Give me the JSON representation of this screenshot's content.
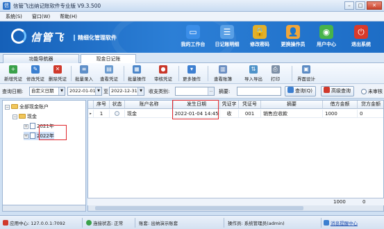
{
  "window": {
    "title": "信管飞出纳记账软件专业版 V9.3.500",
    "min": "–",
    "max": "□",
    "close": "✕"
  },
  "menu": [
    "系统(S)",
    "窗口(W)",
    "帮助(H)"
  ],
  "banner": {
    "logo": "信管飞",
    "slogan": "精细化管理软件",
    "tools": [
      {
        "label": "我的工作台",
        "icon": "monitor-icon",
        "color": "#3b8ee8",
        "glyph": "▭"
      },
      {
        "label": "日记账明细",
        "icon": "ledger-icon",
        "color": "#5aa0e6",
        "glyph": "☰"
      },
      {
        "label": "修改密码",
        "icon": "lock-icon",
        "color": "#e2b02a",
        "glyph": "🔒"
      },
      {
        "label": "更换操作员",
        "icon": "user-icon",
        "color": "#f0a63a",
        "glyph": "👤"
      },
      {
        "label": "用户中心",
        "icon": "globe-icon",
        "color": "#47b34a",
        "glyph": "◉"
      },
      {
        "label": "退出系统",
        "icon": "power-icon",
        "color": "#d93a2b",
        "glyph": "⏻"
      }
    ]
  },
  "tabs": [
    {
      "label": "功能导航器",
      "active": false
    },
    {
      "label": "现金日记账",
      "active": true
    }
  ],
  "toolbar": [
    {
      "label": "新增凭证",
      "icon": "add-icon",
      "color": "#3aa14a",
      "glyph": "+"
    },
    {
      "label": "修改凭证",
      "icon": "edit-icon",
      "color": "#3a7fd0",
      "glyph": "✎"
    },
    {
      "label": "删除凭证",
      "icon": "delete-icon",
      "color": "#d0392b",
      "glyph": "✕"
    },
    {
      "label": "批量录入",
      "icon": "batch-input-icon",
      "color": "#5f8fc8",
      "glyph": "≡"
    },
    {
      "label": "查看凭证",
      "icon": "view-icon",
      "color": "#6a9bd0",
      "glyph": "▤"
    },
    {
      "label": "批量操作",
      "icon": "batch-icon",
      "color": "#4c86c9",
      "glyph": "▦"
    },
    {
      "label": "审核凭证",
      "icon": "audit-icon",
      "color": "#c9372a",
      "glyph": "●"
    },
    {
      "label": "更多操作",
      "icon": "more-icon",
      "color": "#3d7fd1",
      "glyph": "▾"
    },
    {
      "label": "查看账簿",
      "icon": "books-icon",
      "color": "#6c8fc2",
      "glyph": "▥"
    },
    {
      "label": "导入导出",
      "icon": "import-export-icon",
      "color": "#4f93c9",
      "glyph": "⇅"
    },
    {
      "label": "打印",
      "icon": "print-icon",
      "color": "#7d8fa6",
      "glyph": "⎙"
    },
    {
      "label": "界面设计",
      "icon": "design-icon",
      "color": "#5c8bc4",
      "glyph": "▣"
    }
  ],
  "query": {
    "date_label": "查询日期:",
    "date_mode": "自定义日期",
    "date_from": "2022-01-01",
    "to_label": "至",
    "date_to": "2022-12-31",
    "category_label": "收支类别:",
    "category_value": "",
    "summary_label": "摘要:",
    "summary_value": "",
    "query_button": "查询(Q)",
    "advanced_button": "高级查询",
    "unaudited_label": "未审核"
  },
  "tree": {
    "root": "全部现金账户",
    "account": "现金",
    "years": [
      "2021年",
      "2022年"
    ]
  },
  "grid": {
    "columns": [
      "序号",
      "状态",
      "账户名称",
      "发生日期",
      "凭证字",
      "凭证号",
      "摘要",
      "借方金额",
      "贷方金额"
    ],
    "rows": [
      {
        "no": "1",
        "status": "",
        "account": "现金",
        "date": "2022-01-04 14:45",
        "voucher_word": "收",
        "voucher_no": "001",
        "summary": "销售应收款",
        "debit": "1000",
        "credit": "0"
      }
    ],
    "totals": {
      "debit": "1000",
      "credit": "0"
    }
  },
  "status_bar": {
    "app_center": "应用中心: 127.0.0.1:7092",
    "connection": "连接状态: 正常",
    "book": "账套: 出纳演示账套",
    "operator": "操作员: 系统管理员(admin)",
    "messages": "消息提醒中心"
  }
}
